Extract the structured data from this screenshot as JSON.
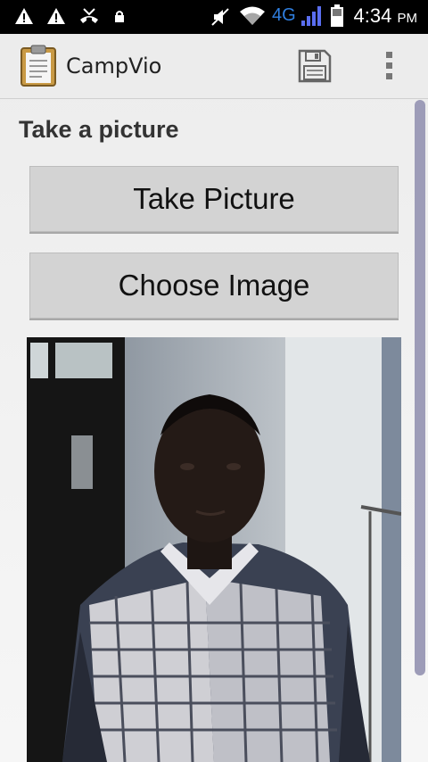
{
  "status_bar": {
    "time": "4:34",
    "ampm": "PM",
    "network": "4G",
    "icons": [
      "warning-icon",
      "warning-icon",
      "missed-call-icon",
      "lock-icon",
      "mute-icon",
      "wifi-icon",
      "signal-icon",
      "battery-icon"
    ]
  },
  "action_bar": {
    "title": "CampVio",
    "app_icon": "clipboard-icon",
    "save_icon": "floppy-disk-icon",
    "overflow_icon": "overflow-menu-icon"
  },
  "content": {
    "section_title": "Take a picture",
    "take_picture_label": "Take Picture",
    "choose_image_label": "Choose Image",
    "photo": "captured-photo-of-person"
  },
  "colors": {
    "status_bar_bg": "#000000",
    "network_4g": "#2f7fe0",
    "button_bg": "#d3d3d3",
    "scrollbar": "#9d9cb8"
  }
}
